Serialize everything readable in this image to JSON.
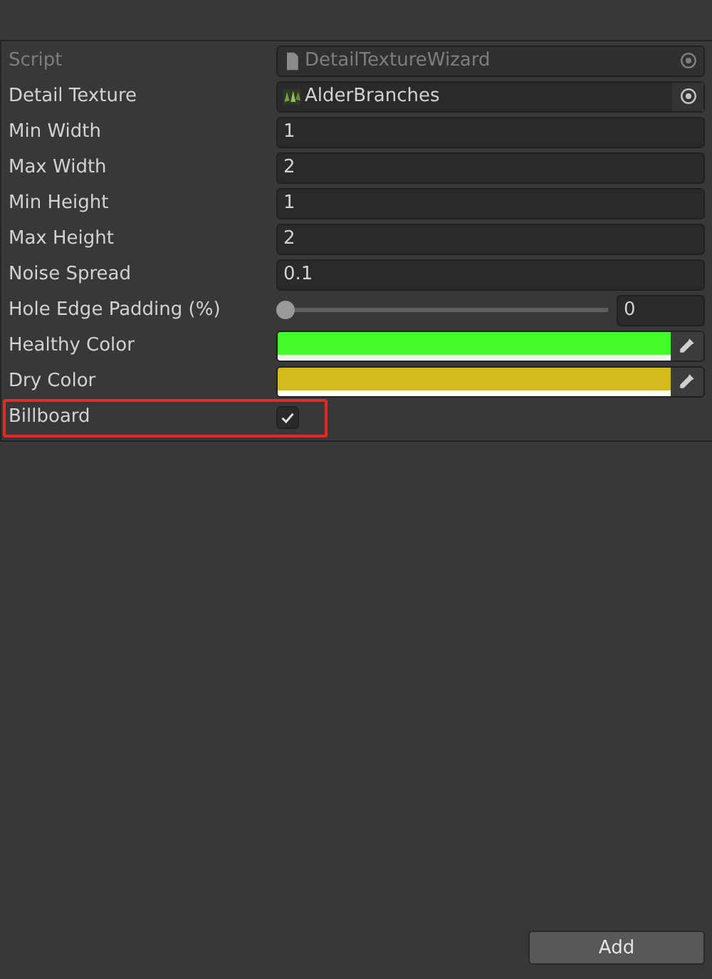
{
  "fields": [
    {
      "kind": "object",
      "label": "Script",
      "value": "DetailTextureWizard",
      "disabled": true,
      "highlighted": false
    },
    {
      "kind": "object",
      "label": "Detail Texture",
      "value": "AlderBranches",
      "disabled": false,
      "highlighted": false
    },
    {
      "kind": "text",
      "label": "Min Width",
      "value": "1",
      "highlighted": false
    },
    {
      "kind": "text",
      "label": "Max Width",
      "value": "2",
      "highlighted": false
    },
    {
      "kind": "text",
      "label": "Min Height",
      "value": "1",
      "highlighted": false
    },
    {
      "kind": "text",
      "label": "Max Height",
      "value": "2",
      "highlighted": false
    },
    {
      "kind": "text",
      "label": "Noise Spread",
      "value": "0.1",
      "highlighted": false
    },
    {
      "kind": "slider",
      "label": "Hole Edge Padding (%)",
      "level": 0,
      "value": "0",
      "highlighted": false
    },
    {
      "kind": "color",
      "label": "Healthy Color",
      "color": "#44fb2c",
      "highlighted": false
    },
    {
      "kind": "color",
      "label": "Dry Color",
      "color": "#d3bb1c",
      "highlighted": false
    },
    {
      "kind": "toggle",
      "label": "Billboard",
      "checked": true,
      "highlighted": true
    }
  ],
  "buttons": [
    {
      "label": "Add"
    }
  ]
}
